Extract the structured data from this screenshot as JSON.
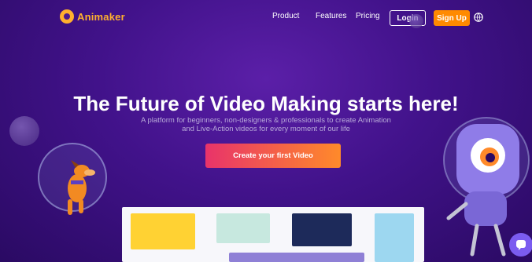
{
  "brand": {
    "name": "Animaker",
    "accent": "#ffb02e"
  },
  "nav": {
    "product": "Product",
    "features": "Features",
    "pricing": "Pricing",
    "login": "Login",
    "signup": "Sign Up",
    "language_icon": "globe-icon"
  },
  "hero": {
    "headline": "The Future of Video Making starts here!",
    "subline_1": "A platform for beginners, non-designers & professionals to create Animation",
    "subline_2": "and Live-Action videos for every moment of our life",
    "cta": "Create your first Video"
  },
  "colors": {
    "background": "#41128a",
    "signup": "#ff8a00",
    "cta_start": "#e8336a",
    "cta_end": "#ff8a2a",
    "chat": "#7b5cf0"
  },
  "preview": {
    "cards": [
      {
        "name": "yellow-photo-card"
      },
      {
        "name": "green-pet-card"
      },
      {
        "name": "navy-party-card"
      },
      {
        "name": "sky-blue-card"
      },
      {
        "name": "purple-bottom-card"
      }
    ]
  },
  "widgets": {
    "chat_icon": "chat-bubble-icon"
  }
}
